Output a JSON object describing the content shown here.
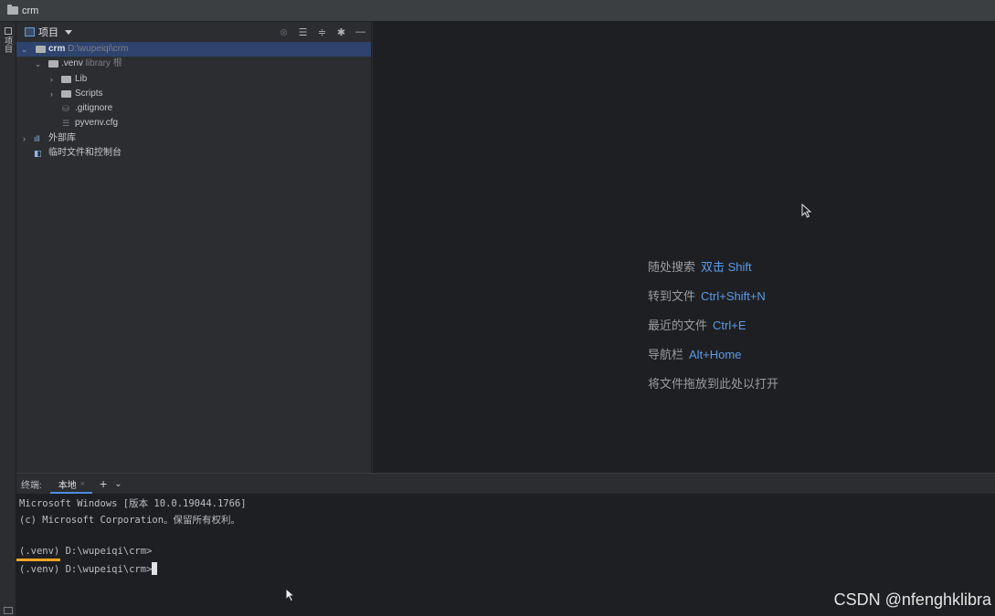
{
  "window": {
    "title": "crm"
  },
  "left_strip": {
    "tab_label": "项目"
  },
  "project": {
    "header_label": "项目",
    "tools": [
      "locate-icon",
      "expand-all-icon",
      "collapse-all-icon",
      "gear-icon",
      "minimize-icon"
    ],
    "tree": [
      {
        "name": "crm",
        "path": "D:\\wupeiqi\\crm"
      },
      {
        "name": ".venv",
        "hint": "library 根"
      },
      {
        "name": "Lib"
      },
      {
        "name": "Scripts"
      },
      {
        "name": ".gitignore"
      },
      {
        "name": "pyvenv.cfg"
      },
      {
        "name": "外部库"
      },
      {
        "name": "临时文件和控制台"
      }
    ]
  },
  "editor": {
    "hints": [
      {
        "label": "随处搜索",
        "key": "双击 Shift"
      },
      {
        "label": "转到文件",
        "key": "Ctrl+Shift+N"
      },
      {
        "label": "最近的文件",
        "key": "Ctrl+E"
      },
      {
        "label": "导航栏",
        "key": "Alt+Home"
      },
      {
        "label": "将文件拖放到此处以打开",
        "key": ""
      }
    ]
  },
  "terminal": {
    "label": "终端:",
    "tab": "本地",
    "lines": [
      "Microsoft Windows [版本 10.0.19044.1766]",
      "(c) Microsoft Corporation。保留所有权利。",
      "",
      "(.venv) D:\\wupeiqi\\crm>",
      "(.venv) D:\\wupeiqi\\crm>"
    ]
  },
  "watermark": "CSDN @nfenghklibra"
}
